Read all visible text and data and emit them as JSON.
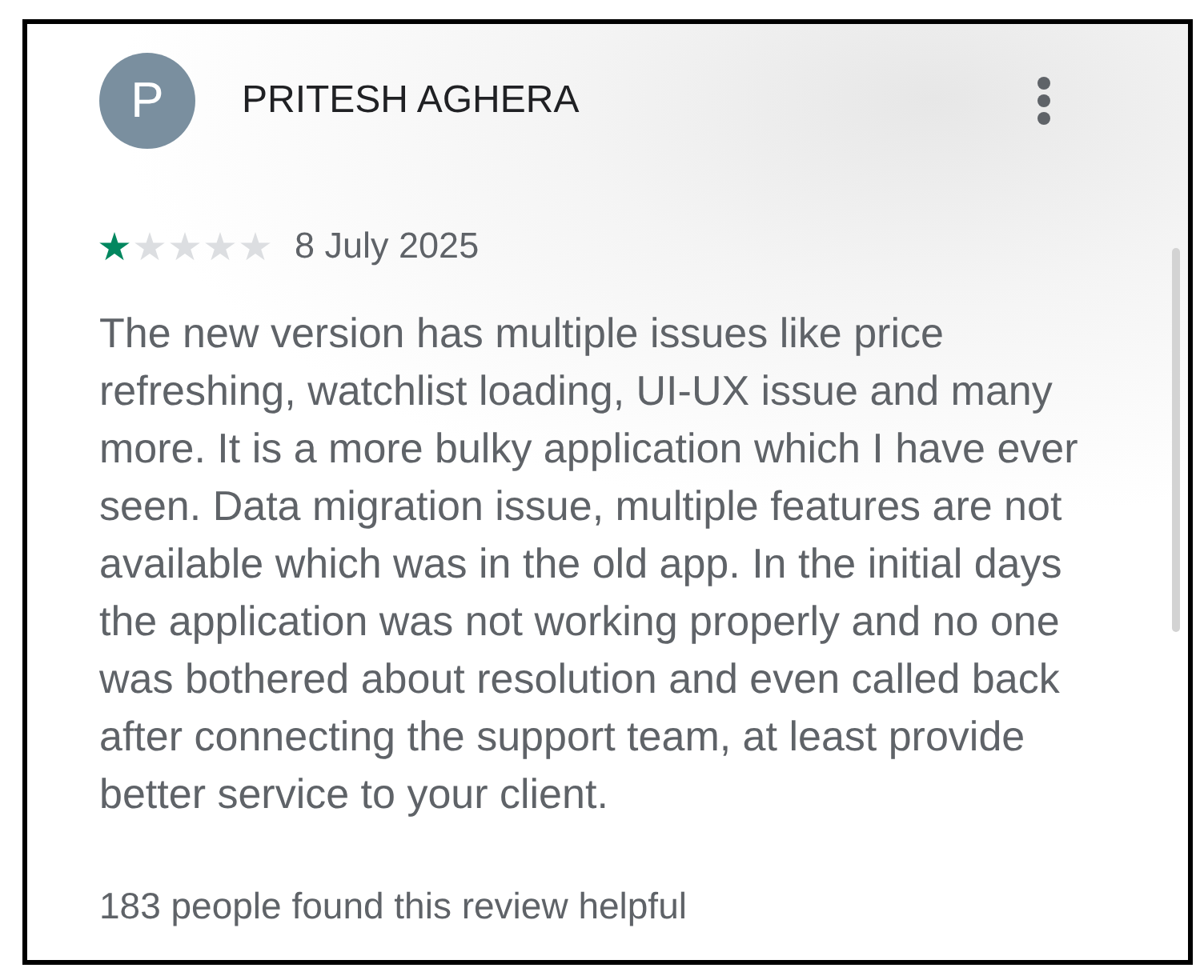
{
  "review": {
    "author": {
      "initial": "P",
      "name": "PRITESH AGHERA"
    },
    "rating": {
      "stars": 1
    },
    "date": "8 July 2025",
    "text": "The new version has multiple issues like price refreshing, watchlist loading, UI-UX issue and many more. It is a more bulky application which I have ever seen. Data migration issue, multiple features are not available which was in the old app. In the initial days the application was not working properly and no one was bothered about resolution and even called back after connecting the support team, at least provide better service to your client.",
    "helpful": "183 people found this review helpful"
  }
}
